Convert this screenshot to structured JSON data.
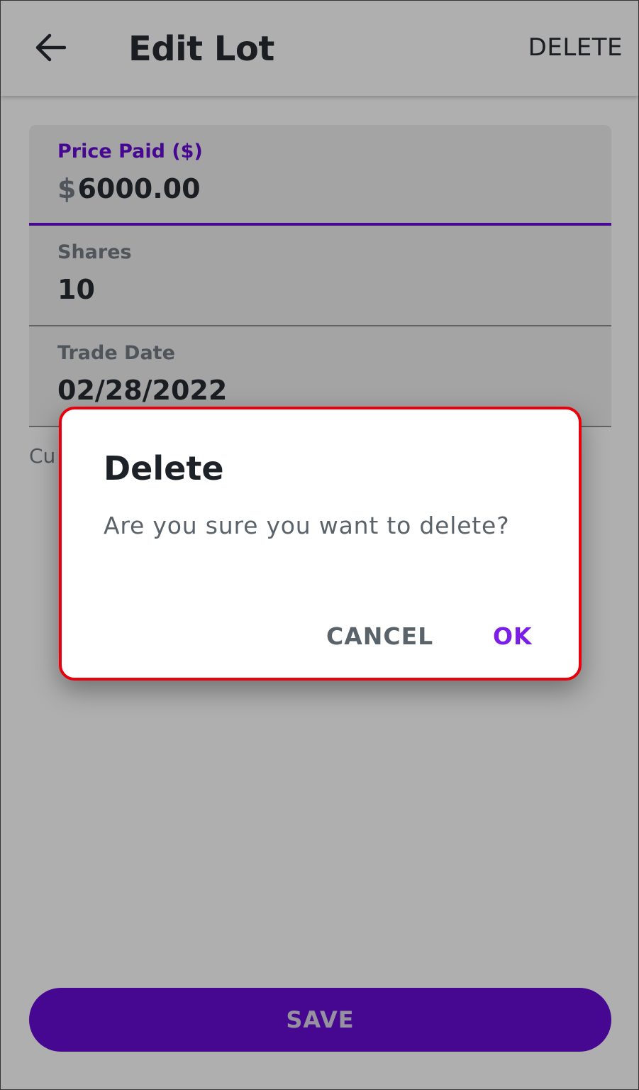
{
  "app_bar": {
    "title": "Edit Lot",
    "action_label": "DELETE"
  },
  "form": {
    "price_paid": {
      "label": "Price Paid ($)",
      "prefix": "$",
      "value": "6000.00"
    },
    "shares": {
      "label": "Shares",
      "value": "10"
    },
    "trade_date": {
      "label": "Trade Date",
      "value": "02/28/2022"
    },
    "helper_text": "Cu"
  },
  "save_button": {
    "label": "SAVE"
  },
  "dialog": {
    "title": "Delete",
    "message": "Are you sure you want to delete?",
    "cancel_label": "CANCEL",
    "ok_label": "OK"
  },
  "colors": {
    "accent": "#6001d2",
    "dialog_ok": "#7b1fe8",
    "highlight_border": "#e8000c"
  },
  "icons": {
    "back": "arrow-left-icon"
  }
}
